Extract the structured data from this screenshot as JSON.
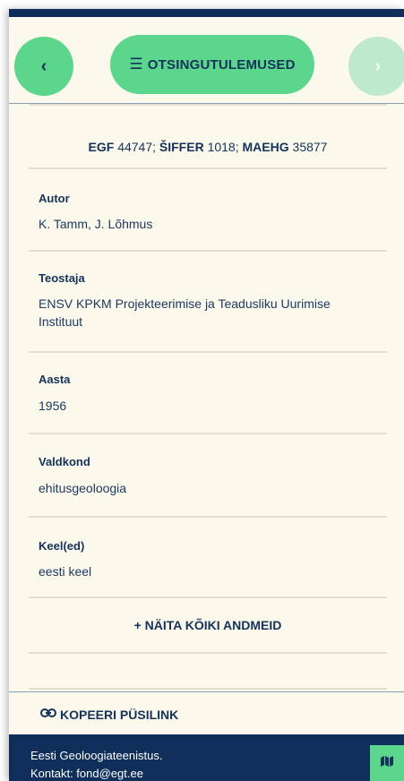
{
  "nav": {
    "prev_label": "‹",
    "results_label": "OTSINGUTULEMUSED",
    "next_label": "›"
  },
  "record": {
    "ids": {
      "egf_label": "EGF",
      "egf_value": "44747;",
      "shiffer_label": "ŠIFFER",
      "shiffer_value": "1018;",
      "maehg_label": "MAEHG",
      "maehg_value": "35877"
    },
    "fields": [
      {
        "label": "Autor",
        "value": "K. Tamm, J. Lõhmus"
      },
      {
        "label": "Teostaja",
        "value": "ENSV KPKM Projekteerimise ja Teadusliku Uurimise Instituut"
      },
      {
        "label": "Aasta",
        "value": "1956"
      },
      {
        "label": "Valdkond",
        "value": "ehitusgeoloogia"
      },
      {
        "label": "Keel(ed)",
        "value": "eesti keel"
      }
    ],
    "show_all_label": "+ NÄITA KÕIKI ANDMEID"
  },
  "footer": {
    "copy_link_label": "KOPEERI PÜSILINK",
    "org_line1": "Eesti Geoloogiateenistus.",
    "org_line2": "Kontakt: fond@egt.ee"
  },
  "colors": {
    "primary": "#5dd68d",
    "navy": "#0f2f5a",
    "background": "#fbf8ec"
  },
  "icons": [
    "list-icon",
    "link-icon",
    "map-icon"
  ]
}
